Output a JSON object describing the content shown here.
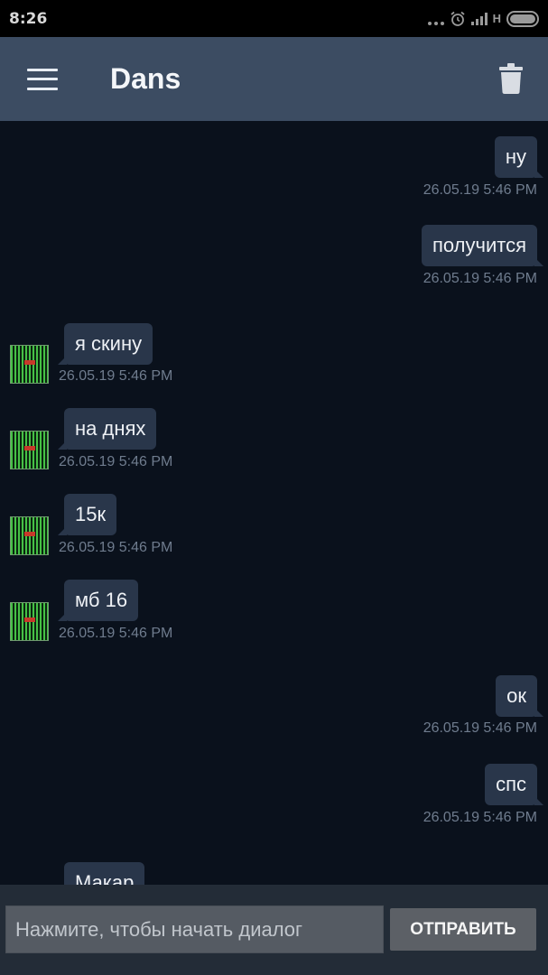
{
  "status_bar": {
    "time": "8:26",
    "network": "H"
  },
  "app_bar": {
    "title": "Dans"
  },
  "messages": [
    {
      "direction": "out",
      "text": "ну",
      "time": "26.05.19 5:46 PM"
    },
    {
      "direction": "out",
      "text": "получится",
      "time": "26.05.19 5:46 PM"
    },
    {
      "direction": "in",
      "text": "я скину",
      "time": "26.05.19 5:46 PM"
    },
    {
      "direction": "in",
      "text": "на днях",
      "time": "26.05.19 5:46 PM"
    },
    {
      "direction": "in",
      "text": "15к",
      "time": "26.05.19 5:46 PM"
    },
    {
      "direction": "in",
      "text": "мб 16",
      "time": "26.05.19 5:46 PM"
    },
    {
      "direction": "out",
      "text": "ок",
      "time": "26.05.19 5:46 PM"
    },
    {
      "direction": "out",
      "text": "спс",
      "time": "26.05.19 5:46 PM"
    },
    {
      "direction": "in",
      "text": "Макар",
      "time": ""
    }
  ],
  "composer": {
    "placeholder": "Нажмите, чтобы начать диалог",
    "send_label": "ОТПРАВИТЬ"
  },
  "colors": {
    "app_bar": "#3c4c62",
    "background": "#0a111c",
    "bubble": "#29364a",
    "timestamp": "#6f7c8e"
  }
}
